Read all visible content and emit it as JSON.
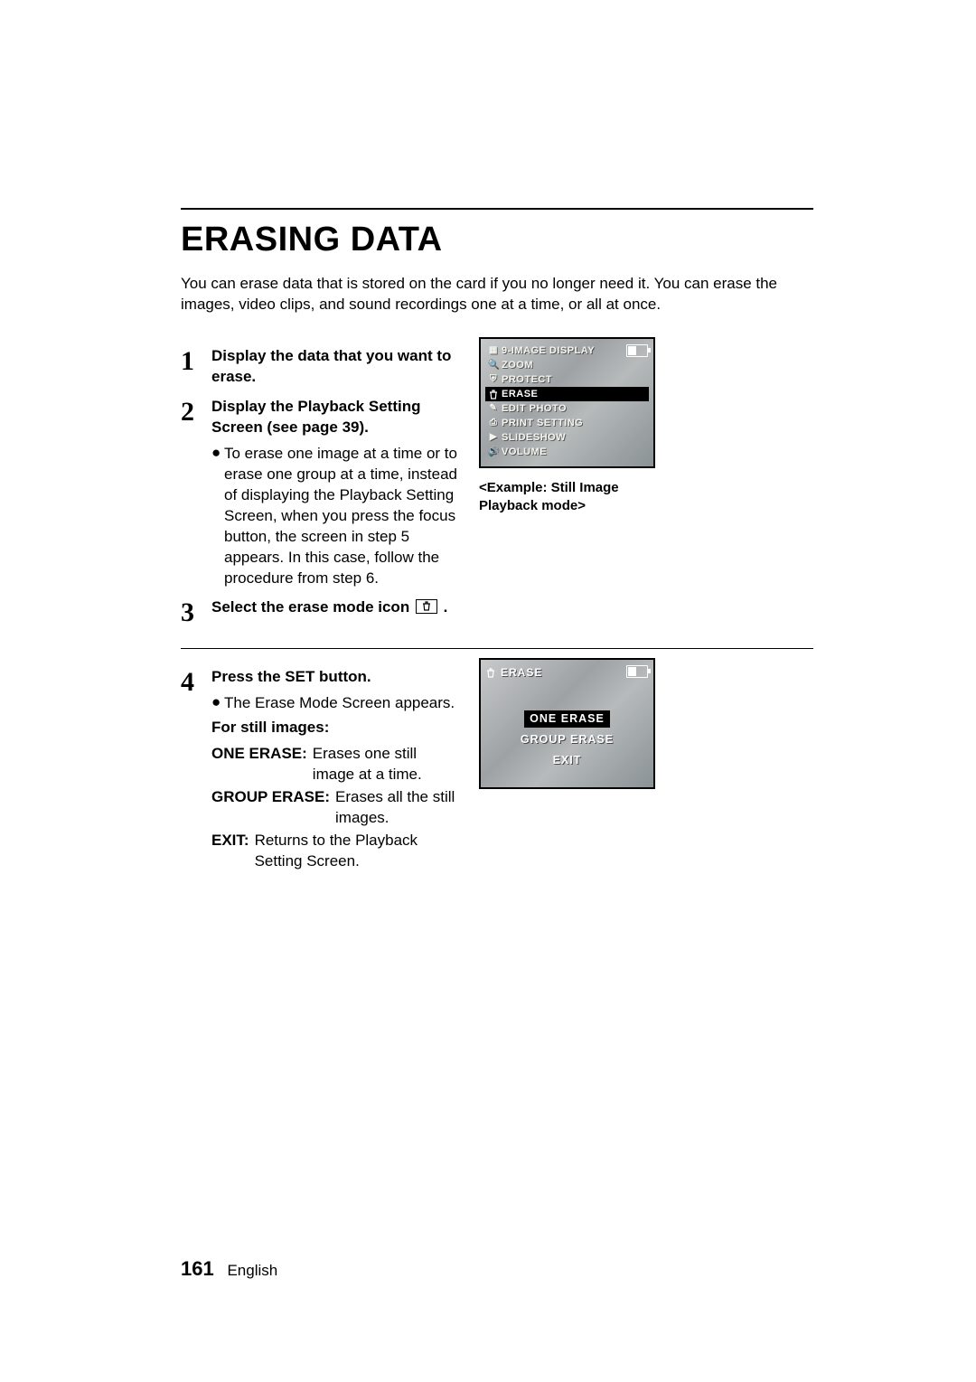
{
  "title": "ERASING DATA",
  "intro": "You can erase data that is stored on the card if you no longer need it. You can erase the images, video clips, and sound recordings one at a time, or all at once.",
  "steps": {
    "s1": {
      "num": "1",
      "head": "Display the data that you want to erase."
    },
    "s2": {
      "num": "2",
      "head": "Display the Playback Setting Screen (see page 39).",
      "bullet": "To erase one image at a time or to erase one group at a time, instead of displaying the Playback Setting Screen, when you press the focus button, the screen in step 5 appears. In this case, follow the procedure from step 6."
    },
    "s3": {
      "num": "3",
      "head_a": "Select the erase mode icon ",
      "head_b": "."
    },
    "s4": {
      "num": "4",
      "head": "Press the SET button.",
      "bullet": "The Erase Mode Screen appears.",
      "for_label": "For still images:",
      "defs": {
        "one_erase_l": "ONE ERASE:",
        "one_erase_t": "Erases one still image at a time.",
        "group_erase_l": "GROUP ERASE:",
        "group_erase_t": "Erases all the still images.",
        "exit_l": "EXIT:",
        "exit_t": "Returns to the Playback Setting Screen."
      }
    }
  },
  "lcd1": {
    "menu": [
      "9-IMAGE DISPLAY",
      "ZOOM",
      "PROTECT",
      "ERASE",
      "EDIT PHOTO",
      "PRINT SETTING",
      "SLIDESHOW",
      "VOLUME"
    ],
    "selected_index": 3,
    "caption": "<Example: Still Image Playback mode>"
  },
  "lcd2": {
    "header": "ERASE",
    "options": [
      "ONE ERASE",
      "GROUP ERASE",
      "EXIT"
    ],
    "selected_index": 0
  },
  "footer": {
    "page": "161",
    "lang": "English"
  }
}
